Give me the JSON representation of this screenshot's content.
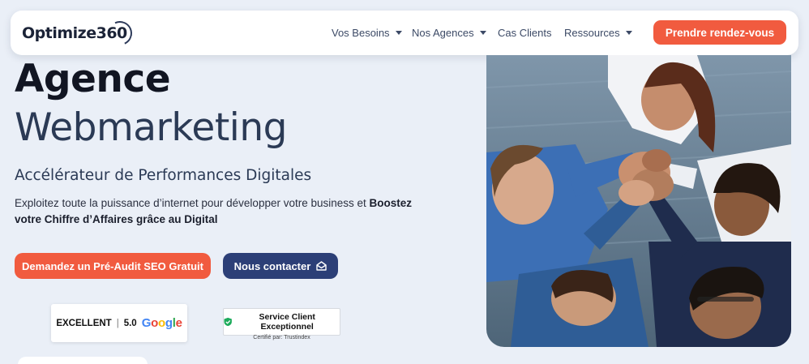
{
  "header": {
    "logo_text": "Optimize",
    "logo_number": "360",
    "nav": [
      {
        "label": "Vos Besoins",
        "has_caret": true
      },
      {
        "label": "Nos Agences",
        "has_caret": true
      },
      {
        "label": "Cas Clients",
        "has_caret": false
      },
      {
        "label": "Ressources",
        "has_caret": true
      }
    ],
    "cta_label": "Prendre rendez-vous"
  },
  "hero": {
    "title_line1": "Agence",
    "title_line2": "Webmarketing",
    "subtitle": "Accélérateur de Performances Digitales",
    "description_plain": "Exploitez toute la puissance d’internet pour développer votre business et ",
    "description_bold": "Boostez votre Chiffre d’Affaires grâce au Digital",
    "audit_button": "Demandez un Pré-Audit SEO Gratuit",
    "contact_button": "Nous contacter"
  },
  "badges": {
    "google": {
      "rating_label": "EXCELLENT",
      "separator": "|",
      "score": "5.0",
      "brand": "Google"
    },
    "trustindex": {
      "title": "Service Client Exceptionnel",
      "subtitle": "Certifié par: Trustindex"
    }
  },
  "colors": {
    "accent": "#f15b3f",
    "navy": "#2c3f77",
    "background": "#eaeff7"
  }
}
